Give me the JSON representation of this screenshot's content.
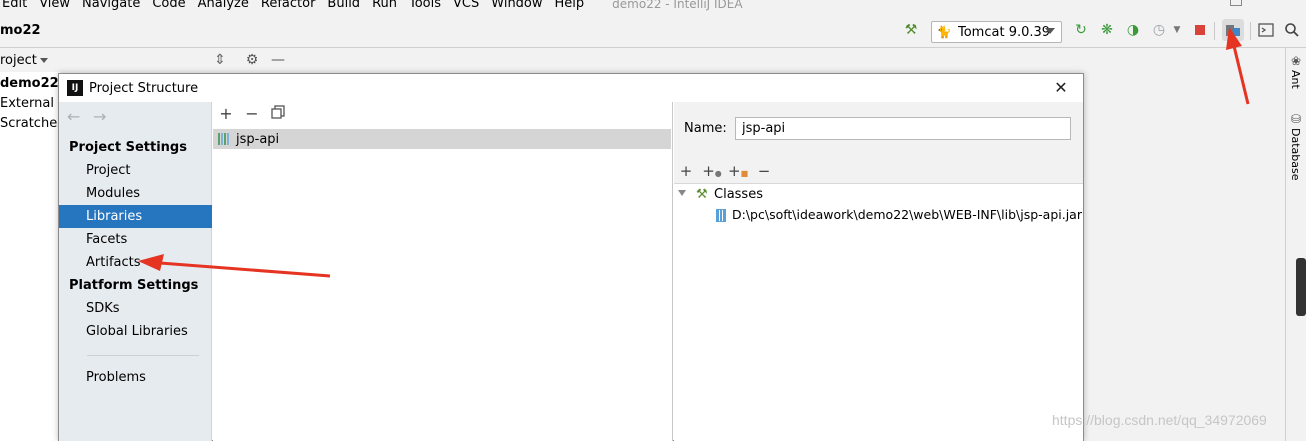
{
  "menu": {
    "items": [
      "Edit",
      "View",
      "Navigate",
      "Code",
      "Analyze",
      "Refactor",
      "Build",
      "Run",
      "Tools",
      "VCS",
      "Window",
      "Help"
    ],
    "window_title": "demo22 - IntelliJ IDEA"
  },
  "navbar": {
    "breadcrumb": "mo22",
    "run_config": "Tomcat 9.0.39"
  },
  "project_panel": {
    "title": "roject",
    "tree": [
      "demo22",
      "External Li",
      "Scratches"
    ]
  },
  "right_strip": {
    "tabs": [
      "Ant",
      "Database"
    ]
  },
  "dialog": {
    "title": "Project Structure",
    "sidebar": {
      "project_settings_heading": "Project Settings",
      "project_settings_items": [
        "Project",
        "Modules",
        "Libraries",
        "Facets",
        "Artifacts"
      ],
      "platform_settings_heading": "Platform Settings",
      "platform_settings_items": [
        "SDKs",
        "Global Libraries"
      ],
      "problems": "Problems",
      "selected": "Libraries"
    },
    "libraries": [
      "jsp-api"
    ],
    "details": {
      "name_label": "Name:",
      "name_value": "jsp-api",
      "tree_root": "Classes",
      "jar_path": "D:\\pc\\soft\\ideawork\\demo22\\web\\WEB-INF\\lib\\jsp-api.jar"
    }
  },
  "watermark": "https://blog.csdn.net/qq_34972069",
  "colors": {
    "selection": "#2675bf",
    "sidebar_bg": "#e6ebf0",
    "annotation_arrow": "#e53422"
  },
  "icons": [
    "build-hammer-icon",
    "tomcat-icon",
    "rerun-icon",
    "debug-icon",
    "coverage-icon",
    "profile-icon",
    "stop-icon",
    "project-structure-icon",
    "terminal-icon",
    "search-icon",
    "close-icon",
    "add-icon",
    "remove-icon",
    "copy-icon",
    "library-icon",
    "jar-icon"
  ]
}
